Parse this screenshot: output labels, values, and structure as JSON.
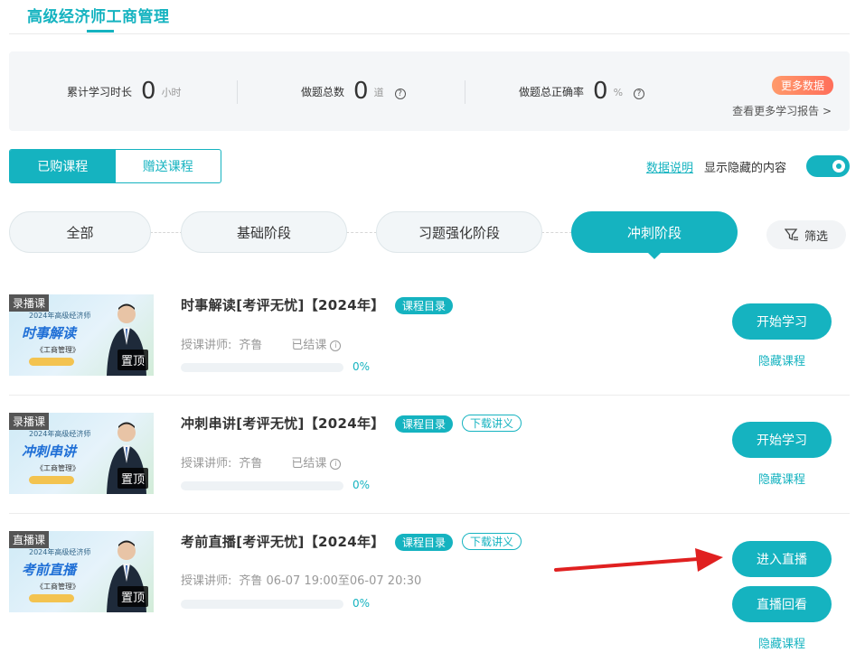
{
  "header": {
    "title": "高级经济师工商管理"
  },
  "stats": {
    "study_time": {
      "label": "累计学习时长",
      "value": "0",
      "unit": "小时"
    },
    "questions": {
      "label": "做题总数",
      "value": "0",
      "unit": "道"
    },
    "accuracy": {
      "label": "做题总正确率",
      "value": "0",
      "unit": "%"
    },
    "more_data": "更多数据",
    "more_report": "查看更多学习报告 >"
  },
  "tabs": {
    "purchased": "已购课程",
    "gift": "赠送课程"
  },
  "data_explain": "数据说明",
  "show_hidden": "显示隐藏的内容",
  "stages": [
    "全部",
    "基础阶段",
    "习题强化阶段",
    "冲刺阶段"
  ],
  "filter_label": "筛选",
  "courses": [
    {
      "tag": "录播课",
      "thumb_year": "2024年高级经济师",
      "thumb_title": "时事解读",
      "thumb_sub": "《工商管理》",
      "pin": "置顶",
      "title": "时事解读[考评无忧]【2024年】",
      "catalog": "课程目录",
      "teacher_label": "授课讲师:",
      "teacher": "齐鲁",
      "status": "已结课",
      "progress_pct": "0%",
      "primary_btn": "开始学习",
      "hide": "隐藏课程"
    },
    {
      "tag": "录播课",
      "thumb_year": "2024年高级经济师",
      "thumb_title": "冲刺串讲",
      "thumb_sub": "《工商管理》",
      "pin": "置顶",
      "title": "冲刺串讲[考评无忧]【2024年】",
      "catalog": "课程目录",
      "download": "下载讲义",
      "teacher_label": "授课讲师:",
      "teacher": "齐鲁",
      "status": "已结课",
      "progress_pct": "0%",
      "primary_btn": "开始学习",
      "hide": "隐藏课程"
    },
    {
      "tag": "直播课",
      "thumb_year": "2024年高级经济师",
      "thumb_title": "考前直播",
      "thumb_sub": "《工商管理》",
      "pin": "置顶",
      "title": "考前直播[考评无忧]【2024年】",
      "catalog": "课程目录",
      "download": "下载讲义",
      "teacher_label": "授课讲师:",
      "teacher": "齐鲁 06-07 19:00至06-07 20:30",
      "progress_pct": "0%",
      "primary_btn": "进入直播",
      "secondary_btn": "直播回看",
      "hide": "隐藏课程"
    }
  ],
  "colors": {
    "accent": "#15b3c0",
    "badge": "#ff7a5c",
    "arrow": "#e02020"
  }
}
